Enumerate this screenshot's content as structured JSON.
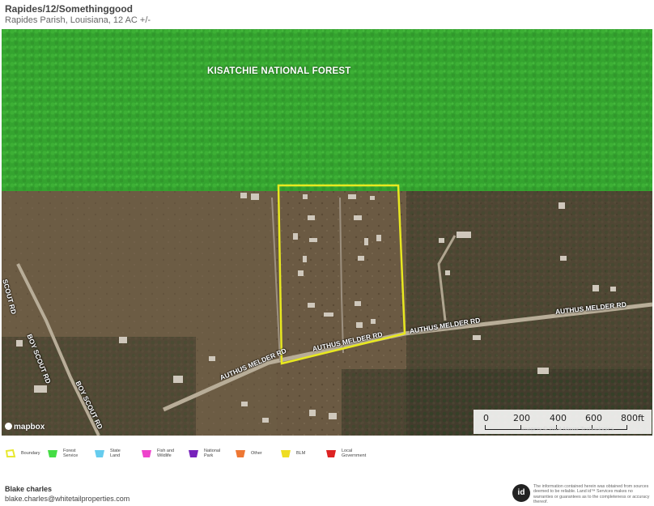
{
  "header": {
    "title": "Rapides/12/Somethinggood",
    "subtitle": "Rapides Parish, Louisiana, 12 AC +/-"
  },
  "map": {
    "forest_label": "KISATCHIE NATIONAL FOREST",
    "roads": {
      "authus_melder_1": "AUTHUS MELDER RD",
      "authus_melder_2": "AUTHUS MELDER RD",
      "authus_melder_3": "AUTHUS MELDER RD",
      "authus_melder_4": "AUTHUS MELDER RD",
      "boy_scout_1": "BOY SCOUT RD",
      "boy_scout_2": "BOY SCOUT RD",
      "scout_rd": "SCOUT RD"
    },
    "logo": "mapbox",
    "scale": {
      "labels": [
        "0",
        "200",
        "400",
        "600",
        "800ft"
      ]
    },
    "attribution": "Imagery © 2024 Maxar Technologies",
    "colors": {
      "forest_overlay": "#3fd03a",
      "boundary": "#e8e820",
      "terrain": "#6a5a42"
    }
  },
  "legend": {
    "items": [
      {
        "label": "Boundary",
        "color": "#e8e830"
      },
      {
        "label": "Forest Service",
        "color": "#44dd44"
      },
      {
        "label": "State Land",
        "color": "#66ccee"
      },
      {
        "label": "Fish and Wildlife",
        "color": "#ee44cc"
      },
      {
        "label": "National Park",
        "color": "#7722bb"
      },
      {
        "label": "Other",
        "color": "#ee7733"
      },
      {
        "label": "BLM",
        "color": "#eedd22"
      },
      {
        "label": "Local Government",
        "color": "#dd2222"
      }
    ]
  },
  "footer": {
    "agent_name": "Blake charles",
    "agent_email": "blake.charles@whitetailproperties.com",
    "logo_text": "id",
    "disclaimer": "The information contained herein was obtained from sources deemed to be reliable. Land id™ Services makes no warranties or guarantees as to the completeness or accuracy thereof."
  }
}
